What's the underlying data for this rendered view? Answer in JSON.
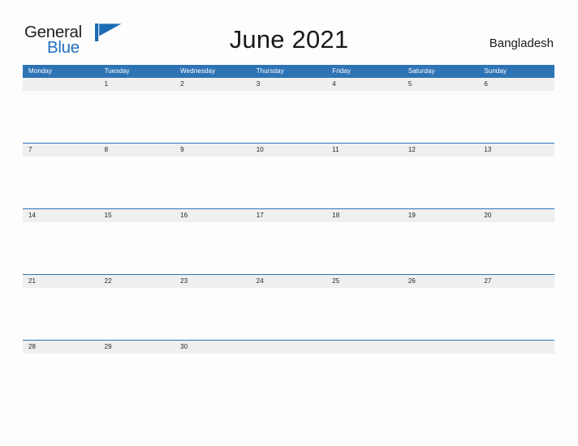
{
  "brand": {
    "name_part1": "General",
    "name_part2": "Blue",
    "flag_icon": "blue-triangle-flag-icon",
    "color_primary": "#2e74b5",
    "color_blue_text": "#1f70c1"
  },
  "header": {
    "title": "June 2021",
    "country": "Bangladesh"
  },
  "calendar": {
    "month": "June",
    "year": "2021",
    "header_bg": "#2e74b5",
    "date_band_bg": "#efefef",
    "weekdays": [
      "Monday",
      "Tuesday",
      "Wednesday",
      "Thursday",
      "Friday",
      "Saturday",
      "Sunday"
    ],
    "weeks": [
      [
        "",
        "1",
        "2",
        "3",
        "4",
        "5",
        "6"
      ],
      [
        "7",
        "8",
        "9",
        "10",
        "11",
        "12",
        "13"
      ],
      [
        "14",
        "15",
        "16",
        "17",
        "18",
        "19",
        "20"
      ],
      [
        "21",
        "22",
        "23",
        "24",
        "25",
        "26",
        "27"
      ],
      [
        "28",
        "29",
        "30",
        "",
        "",
        "",
        ""
      ]
    ]
  }
}
